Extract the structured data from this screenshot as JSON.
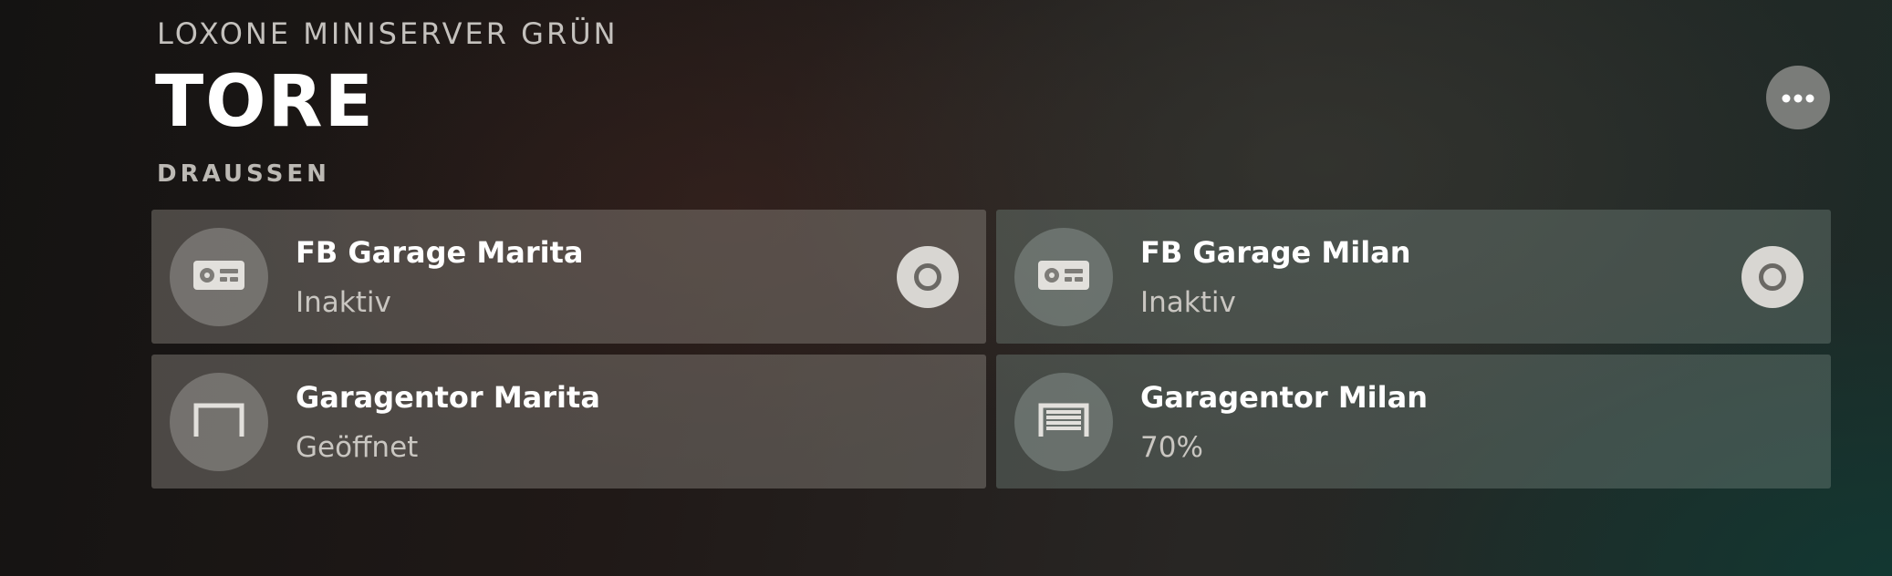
{
  "header": {
    "server_name": "LOXONE MINISERVER GRÜN",
    "title": "TORE",
    "more_icon": "more-horizontal-icon"
  },
  "section": {
    "label": "DRAUSSEN"
  },
  "cards": [
    {
      "title": "FB Garage Marita",
      "status": "Inaktiv",
      "icon": "remote-control-icon",
      "action_icon": "circle-button-icon"
    },
    {
      "title": "FB Garage Milan",
      "status": "Inaktiv",
      "icon": "remote-control-icon",
      "action_icon": "circle-button-icon"
    },
    {
      "title": "Garagentor Marita",
      "status": "Geöffnet",
      "icon": "garage-door-open-icon"
    },
    {
      "title": "Garagentor Milan",
      "status": "70%",
      "icon": "garage-door-partial-icon"
    }
  ],
  "colors": {
    "accent": "#ffffff",
    "card_warm": "#6b6561",
    "card_cool": "#58625e",
    "action_button": "#d8d6d2"
  }
}
